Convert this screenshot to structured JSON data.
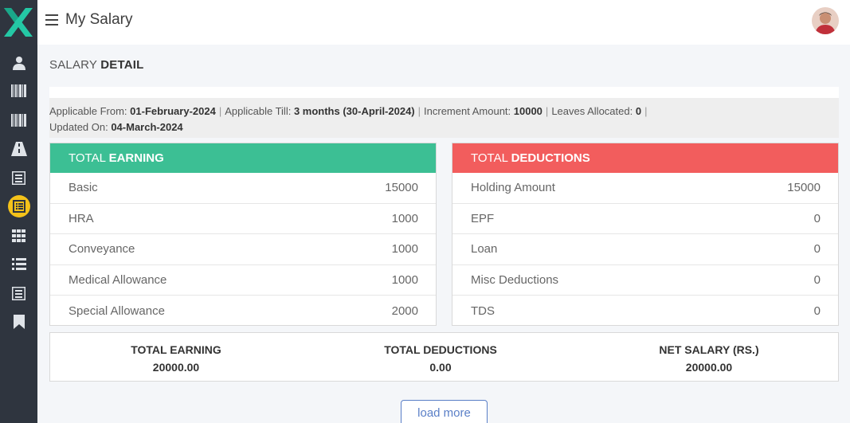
{
  "app": {
    "title": "My Salary"
  },
  "sidebar": {
    "items": [
      {
        "icon": "user-icon"
      },
      {
        "icon": "barcode-icon"
      },
      {
        "icon": "barcode-icon"
      },
      {
        "icon": "road-icon"
      },
      {
        "icon": "document-icon"
      },
      {
        "icon": "list-alt-icon",
        "active": true
      },
      {
        "icon": "grid-icon"
      },
      {
        "icon": "list-icon"
      },
      {
        "icon": "document-icon"
      },
      {
        "icon": "bookmark-icon"
      }
    ],
    "active_color": "#f4c21a"
  },
  "section": {
    "title_light": "SALARY ",
    "title_bold": "DETAIL"
  },
  "info": {
    "applicable_from_label": "Applicable From: ",
    "applicable_from": "01-February-2024",
    "applicable_till_label": "Applicable Till: ",
    "applicable_till": "3 months (30-April-2024)",
    "increment_label": "Increment Amount: ",
    "increment": "10000",
    "leaves_label": "Leaves Allocated: ",
    "leaves": "0",
    "separator": "|",
    "updated_label": "Updated On: ",
    "updated": "04-March-2024"
  },
  "earning": {
    "title_light": "TOTAL ",
    "title_bold": "EARNING",
    "color": "#3cbf94",
    "rows": [
      {
        "label": "Basic",
        "value": "15000"
      },
      {
        "label": "HRA",
        "value": "1000"
      },
      {
        "label": "Conveyance",
        "value": "1000"
      },
      {
        "label": "Medical Allowance",
        "value": "1000"
      },
      {
        "label": "Special Allowance",
        "value": "2000"
      }
    ]
  },
  "deductions": {
    "title_light": "TOTAL ",
    "title_bold": "DEDUCTIONS",
    "color": "#f25d5d",
    "rows": [
      {
        "label": "Holding Amount",
        "value": "15000"
      },
      {
        "label": "EPF",
        "value": "0"
      },
      {
        "label": "Loan",
        "value": "0"
      },
      {
        "label": "Misc Deductions",
        "value": "0"
      },
      {
        "label": "TDS",
        "value": "0"
      }
    ]
  },
  "totals": {
    "earning_label": "TOTAL EARNING",
    "earning_value": "20000.00",
    "deductions_label": "TOTAL DEDUCTIONS",
    "deductions_value": "0.00",
    "net_label": "NET SALARY (RS.)",
    "net_value": "20000.00"
  },
  "load_more": "load more"
}
